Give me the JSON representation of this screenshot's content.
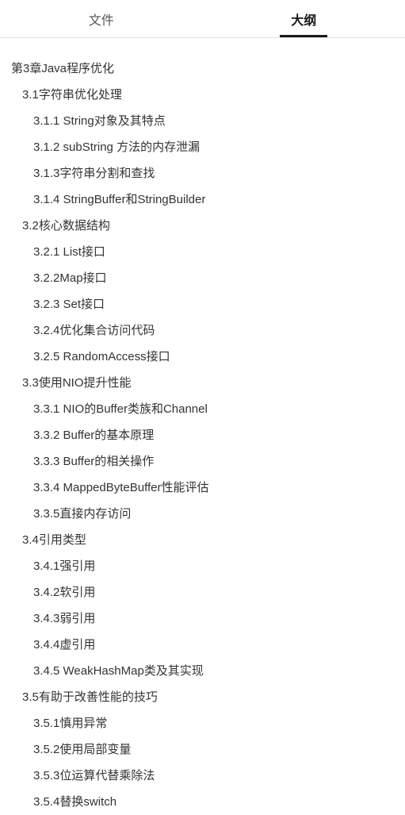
{
  "tabs": {
    "file": "文件",
    "outline": "大纲"
  },
  "outline": [
    {
      "level": 0,
      "text": "第3章Java程序优化"
    },
    {
      "level": 1,
      "text": "3.1字符串优化处理"
    },
    {
      "level": 2,
      "text": "3.1.1 String对象及其特点"
    },
    {
      "level": 2,
      "text": "3.1.2 subString 方法的内存泄漏"
    },
    {
      "level": 2,
      "text": "3.1.3字符串分割和查找"
    },
    {
      "level": 2,
      "text": "3.1.4 StringBuffer和StringBuilder"
    },
    {
      "level": 1,
      "text": "3.2核心数据结构"
    },
    {
      "level": 2,
      "text": "3.2.1 List接口"
    },
    {
      "level": 2,
      "text": "3.2.2Map接口"
    },
    {
      "level": 2,
      "text": "3.2.3 Set接口"
    },
    {
      "level": 2,
      "text": "3.2.4优化集合访问代码"
    },
    {
      "level": 2,
      "text": "3.2.5 RandomAccess接口"
    },
    {
      "level": 1,
      "text": "3.3使用NIO提升性能"
    },
    {
      "level": 2,
      "text": "3.3.1 NIO的Buffer类族和Channel"
    },
    {
      "level": 2,
      "text": "3.3.2 Buffer的基本原理"
    },
    {
      "level": 2,
      "text": "3.3.3 Buffer的相关操作"
    },
    {
      "level": 2,
      "text": "3.3.4 MappedByteBuffer性能评估"
    },
    {
      "level": 2,
      "text": "3.3.5直接内存访问"
    },
    {
      "level": 1,
      "text": "3.4引用类型"
    },
    {
      "level": 2,
      "text": "3.4.1强引用"
    },
    {
      "level": 2,
      "text": "3.4.2软引用"
    },
    {
      "level": 2,
      "text": "3.4.3弱引用"
    },
    {
      "level": 2,
      "text": "3.4.4虚引用"
    },
    {
      "level": 2,
      "text": "3.4.5 WeakHashMap类及其实现"
    },
    {
      "level": 1,
      "text": "3.5有助于改善性能的技巧"
    },
    {
      "level": 2,
      "text": "3.5.1慎用异常"
    },
    {
      "level": 2,
      "text": "3.5.2使用局部变量"
    },
    {
      "level": 2,
      "text": "3.5.3位运算代替乘除法"
    },
    {
      "level": 2,
      "text": "3.5.4替换switch"
    }
  ]
}
